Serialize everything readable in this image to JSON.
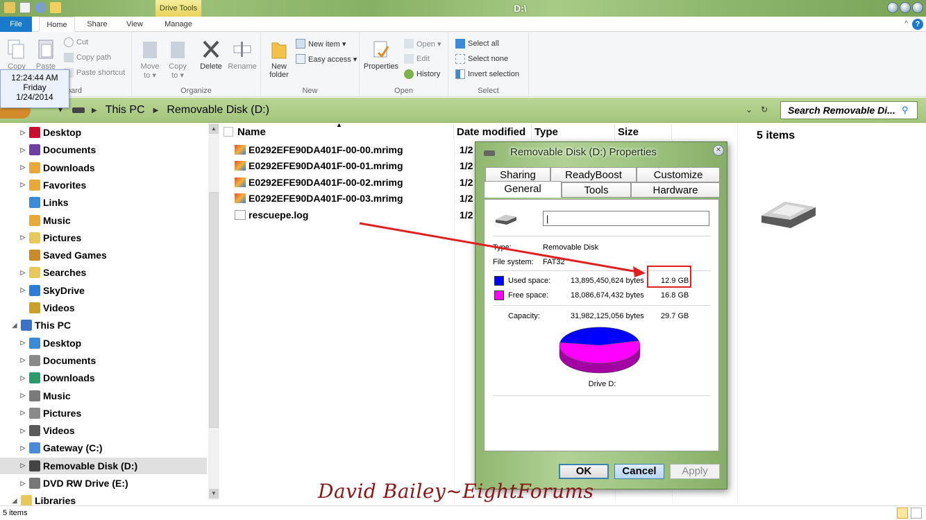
{
  "window": {
    "title": "D:\\",
    "contextual_tab": "Drive Tools"
  },
  "ribbon_tabs": [
    "File",
    "Home",
    "Share",
    "View",
    "Manage"
  ],
  "ribbon": {
    "clipboard": {
      "copy": "Copy",
      "paste": "Paste",
      "cut": "Cut",
      "copy_path": "Copy path",
      "paste_shortcut": "Paste shortcut",
      "group": "Clipboard"
    },
    "organize": {
      "move_to": "Move to ▾",
      "copy_to": "Copy to ▾",
      "delete": "Delete",
      "rename": "Rename",
      "group": "Organize"
    },
    "new": {
      "new_folder": "New folder",
      "new_item": "New item ▾",
      "easy_access": "Easy access ▾",
      "group": "New"
    },
    "open": {
      "properties": "Properties",
      "open": "Open ▾",
      "edit": "Edit",
      "history": "History",
      "group": "Open"
    },
    "select": {
      "select_all": "Select all",
      "select_none": "Select none",
      "invert": "Invert selection",
      "group": "Select"
    }
  },
  "clock": {
    "time": "12:24:44 AM",
    "day": "Friday",
    "date": "1/24/2014"
  },
  "address": {
    "crumbs": [
      "This PC",
      "Removable Disk (D:)"
    ],
    "search_placeholder": "Search Removable Di..."
  },
  "nav": [
    {
      "label": "Desktop",
      "color": "#c8102e",
      "arrow": "▷"
    },
    {
      "label": "Documents",
      "color": "#6d3f9e",
      "arrow": "▷"
    },
    {
      "label": "Downloads",
      "color": "#e7a93a",
      "arrow": "▷"
    },
    {
      "label": "Favorites",
      "color": "#e7a93a",
      "arrow": "▷"
    },
    {
      "label": "Links",
      "color": "#3c8ad6",
      "arrow": ""
    },
    {
      "label": "Music",
      "color": "#e7a93a",
      "arrow": ""
    },
    {
      "label": "Pictures",
      "color": "#e7c85a",
      "arrow": "▷"
    },
    {
      "label": "Saved Games",
      "color": "#c98b2a",
      "arrow": ""
    },
    {
      "label": "Searches",
      "color": "#e7c85a",
      "arrow": "▷"
    },
    {
      "label": "SkyDrive",
      "color": "#2f7cd6",
      "arrow": "▷"
    },
    {
      "label": "Videos",
      "color": "#c9a12a",
      "arrow": ""
    },
    {
      "label": "This PC",
      "color": "#3a73c4",
      "arrow": "◢"
    },
    {
      "label": "Desktop",
      "color": "#3a8ad6",
      "arrow": "▷"
    },
    {
      "label": "Documents",
      "color": "#8a8a8a",
      "arrow": "▷"
    },
    {
      "label": "Downloads",
      "color": "#2a9a6a",
      "arrow": "▷"
    },
    {
      "label": "Music",
      "color": "#7a7a7a",
      "arrow": "▷"
    },
    {
      "label": "Pictures",
      "color": "#8a8a8a",
      "arrow": "▷"
    },
    {
      "label": "Videos",
      "color": "#5a5a5a",
      "arrow": "▷"
    },
    {
      "label": "Gateway (C:)",
      "color": "#4a8ad6",
      "arrow": "▷"
    },
    {
      "label": "Removable Disk (D:)",
      "color": "#444444",
      "arrow": "▷"
    },
    {
      "label": "DVD RW Drive (E:)",
      "color": "#777777",
      "arrow": "▷"
    },
    {
      "label": "Libraries",
      "color": "#e7c85a",
      "arrow": "◢"
    }
  ],
  "columns": {
    "name": "Name",
    "date": "Date modified",
    "type": "Type",
    "size": "Size"
  },
  "files": [
    {
      "name": "E0292EFE90DA401F-00-00.mrimg",
      "date": "1/2"
    },
    {
      "name": "E0292EFE90DA401F-00-01.mrimg",
      "date": "1/2"
    },
    {
      "name": "E0292EFE90DA401F-00-02.mrimg",
      "date": "1/2"
    },
    {
      "name": "E0292EFE90DA401F-00-03.mrimg",
      "date": "1/2"
    },
    {
      "name": "rescuepe.log",
      "date": "1/2"
    }
  ],
  "details": {
    "count": "5 items"
  },
  "status": {
    "text": "5 items"
  },
  "dialog": {
    "title": "Removable Disk (D:) Properties",
    "tabs_row1": [
      "Sharing",
      "ReadyBoost",
      "Customize"
    ],
    "tabs_row2": [
      "General",
      "Tools",
      "Hardware"
    ],
    "name_value": "|",
    "type_label": "Type:",
    "type_value": "Removable Disk",
    "fs_label": "File system:",
    "fs_value": "FAT32",
    "used_label": "Used space:",
    "used_bytes": "13,895,450,624 bytes",
    "used_gb": "12.9 GB",
    "free_label": "Free space:",
    "free_bytes": "18,086,674,432 bytes",
    "free_gb": "16.8 GB",
    "cap_label": "Capacity:",
    "cap_bytes": "31,982,125,056 bytes",
    "cap_gb": "29.7 GB",
    "used_fraction": 0.4345,
    "used_color": "#0000ff",
    "free_color": "#ff00ff",
    "drive_label": "Drive D:",
    "ok": "OK",
    "cancel": "Cancel",
    "apply": "Apply"
  },
  "annotation": {
    "arrow_color": "#e02020"
  },
  "watermark": "David Bailey~EightForums"
}
